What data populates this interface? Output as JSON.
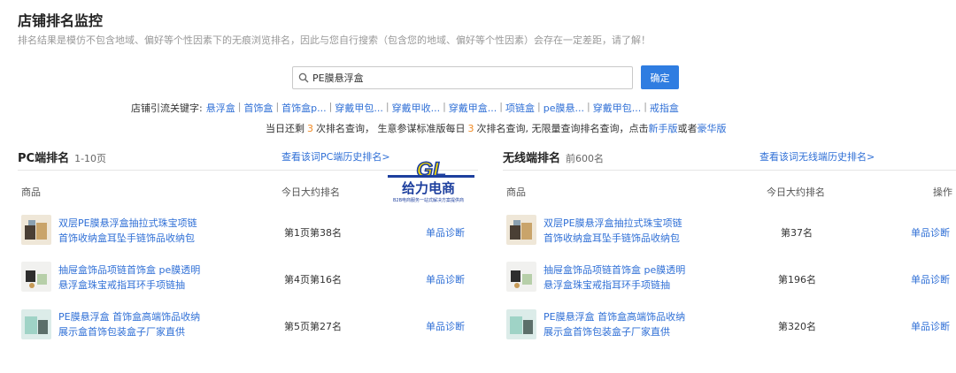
{
  "page": {
    "title": "店铺排名监控",
    "subtitle": "排名结果是模仿不包含地域、偏好等个性因素下的无痕浏览排名，因此与您自行搜索（包含您的地域、偏好等个性因素）会存在一定差距，请了解！"
  },
  "search": {
    "value": "PE膜悬浮盒",
    "button_label": "确定"
  },
  "keywords": {
    "label": "店铺引流关键字:",
    "items": [
      "悬浮盒",
      "首饰盒",
      "首饰盒p...",
      "穿戴甲包...",
      "穿戴甲收...",
      "穿戴甲盒...",
      "项链盒",
      "pe膜悬...",
      "穿戴甲包...",
      "戒指盒"
    ]
  },
  "notice": {
    "p1": "当日还剩",
    "remain": "3",
    "p2": "次排名查询， 生意参谋标准版每日",
    "daily": "3",
    "p3": "次排名查询, 无限量查询排名查询，点击",
    "link1": "新手版",
    "p4": "或者",
    "link2": "豪华版"
  },
  "pc": {
    "heading": "PC端排名",
    "range": "1-10页",
    "history_link": "查看该词PC端历史排名>",
    "col_product": "商品",
    "col_rank": "今日大约排名",
    "rows": [
      {
        "title": "双层PE膜悬浮盒抽拉式珠宝项链首饰收纳盒耳坠手链饰品收纳包",
        "rank": "第1页第38名",
        "action": "单品诊断"
      },
      {
        "title": "抽屉盒饰品项链首饰盒 pe膜透明悬浮盒珠宝戒指耳环手项链抽",
        "rank": "第4页第16名",
        "action": "单品诊断"
      },
      {
        "title": "PE膜悬浮盒 首饰盒高端饰品收纳展示盒首饰包装盒子厂家直供",
        "rank": "第5页第27名",
        "action": "单品诊断"
      }
    ]
  },
  "mobile": {
    "heading": "无线端排名",
    "range": "前600名",
    "history_link": "查看该词无线端历史排名>",
    "col_product": "商品",
    "col_rank": "今日大约排名",
    "col_action": "操作",
    "rows": [
      {
        "title": "双层PE膜悬浮盒抽拉式珠宝项链首饰收纳盒耳坠手链饰品收纳包",
        "rank": "第37名",
        "action": "单品诊断"
      },
      {
        "title": "抽屉盒饰品项链首饰盒 pe膜透明悬浮盒珠宝戒指耳环手项链抽",
        "rank": "第196名",
        "action": "单品诊断"
      },
      {
        "title": "PE膜悬浮盒 首饰盒高端饰品收纳展示盒首饰包装盒子厂家直供",
        "rank": "第320名",
        "action": "单品诊断"
      }
    ]
  },
  "watermark": {
    "logo_text": "GL",
    "name": "给力电商",
    "tagline": "B2B电商服务一站式解决方案提供商"
  },
  "colors": {
    "link": "#2f6fd6",
    "button": "#2f7de1",
    "number": "#f08a24",
    "logo_yellow": "#f5d800",
    "logo_blue": "#1d3f9e"
  }
}
